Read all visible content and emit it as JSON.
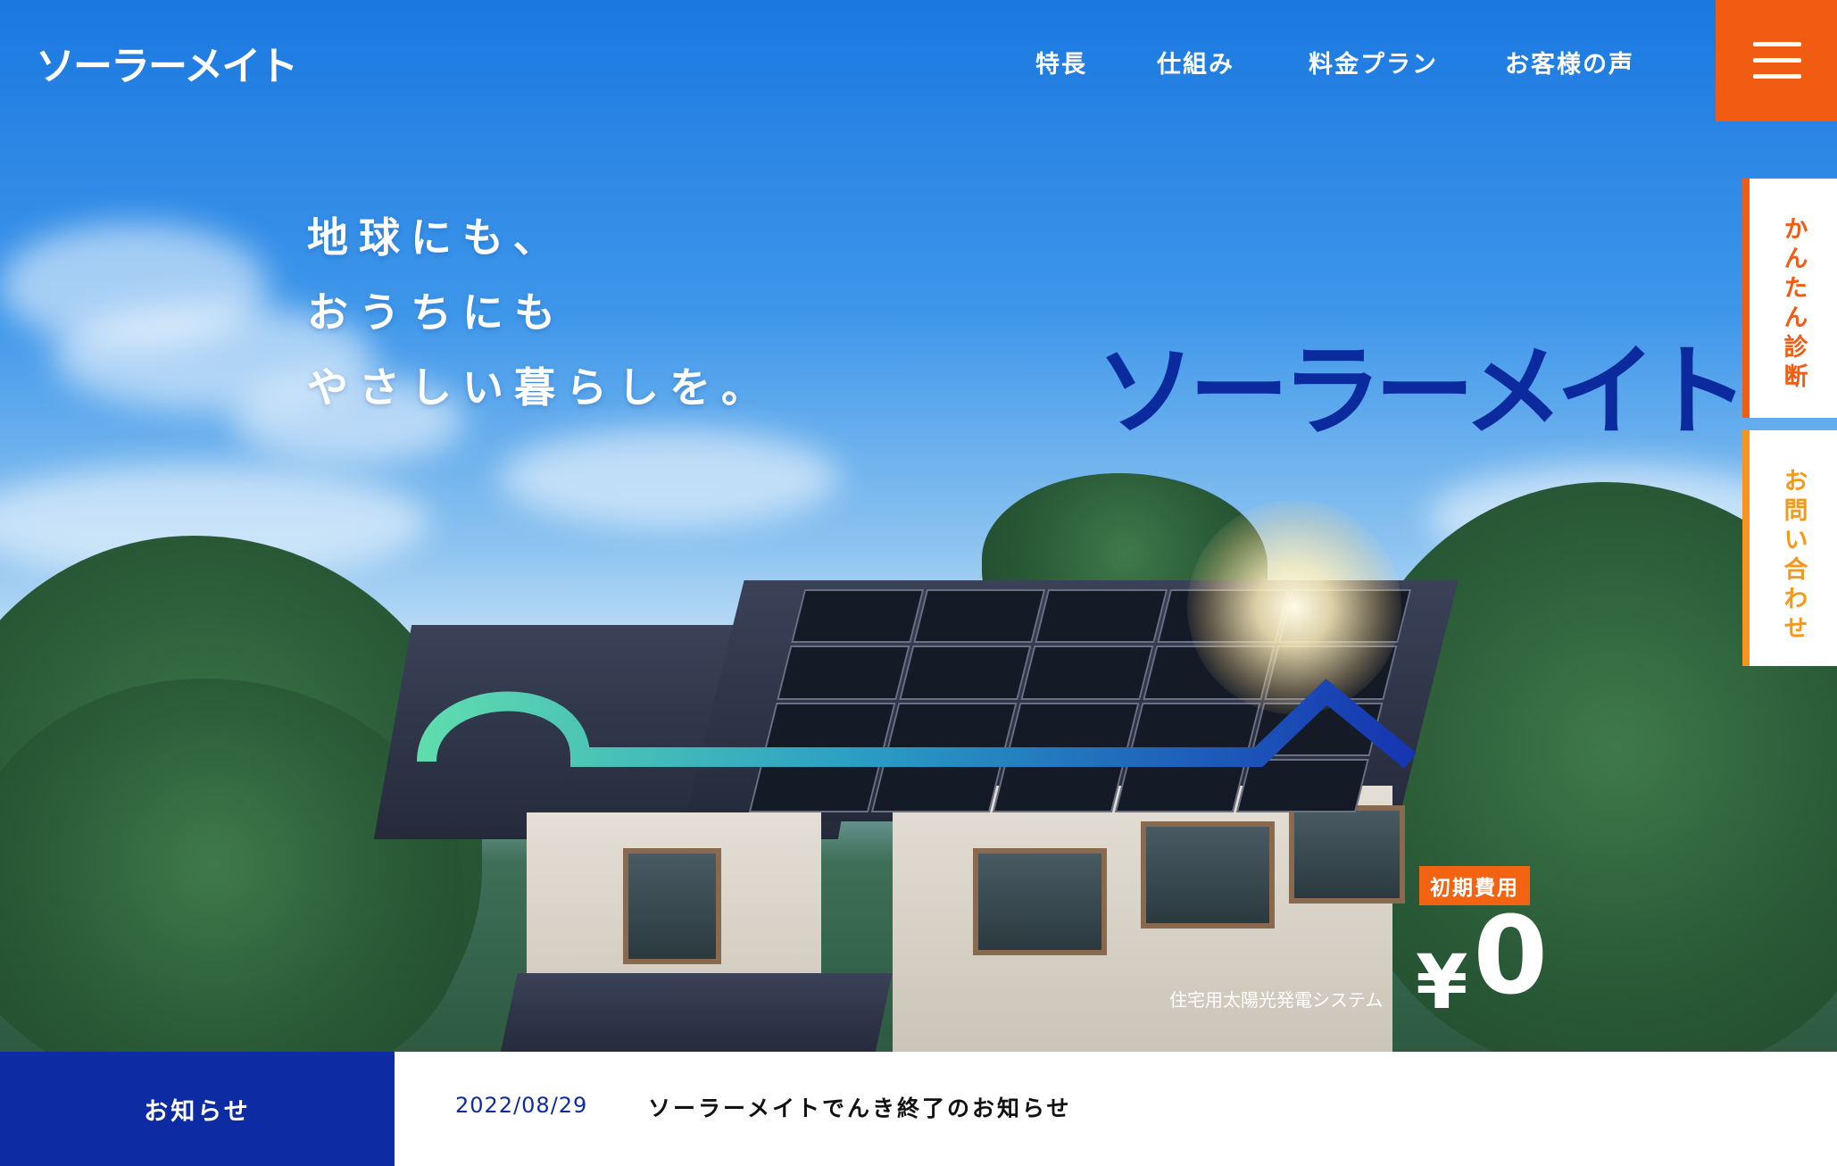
{
  "header": {
    "logo": "ソーラーメイト",
    "nav": [
      {
        "label": "特長"
      },
      {
        "label": "仕組み"
      },
      {
        "label": "料金プラン"
      },
      {
        "label": "お客様の声"
      }
    ],
    "menu_icon": "hamburger-icon"
  },
  "side_tabs": [
    {
      "label": "かんたん診断"
    },
    {
      "label": "お問い合わせ"
    }
  ],
  "hero": {
    "headline": [
      "地球にも、",
      "おうちにも",
      "やさしい暮らしを。"
    ],
    "brand": "ソーラーメイト",
    "badge": "初期費用",
    "price_symbol": "¥",
    "price_value": "0",
    "system_label": "住宅用太陽光発電システム"
  },
  "news": {
    "label": "お知らせ",
    "date": "2022/08/29",
    "title": "ソーラーメイトでんき終了のお知らせ"
  },
  "colors": {
    "accent_orange": "#f25c12",
    "brand_navy": "#0d2ba3"
  }
}
